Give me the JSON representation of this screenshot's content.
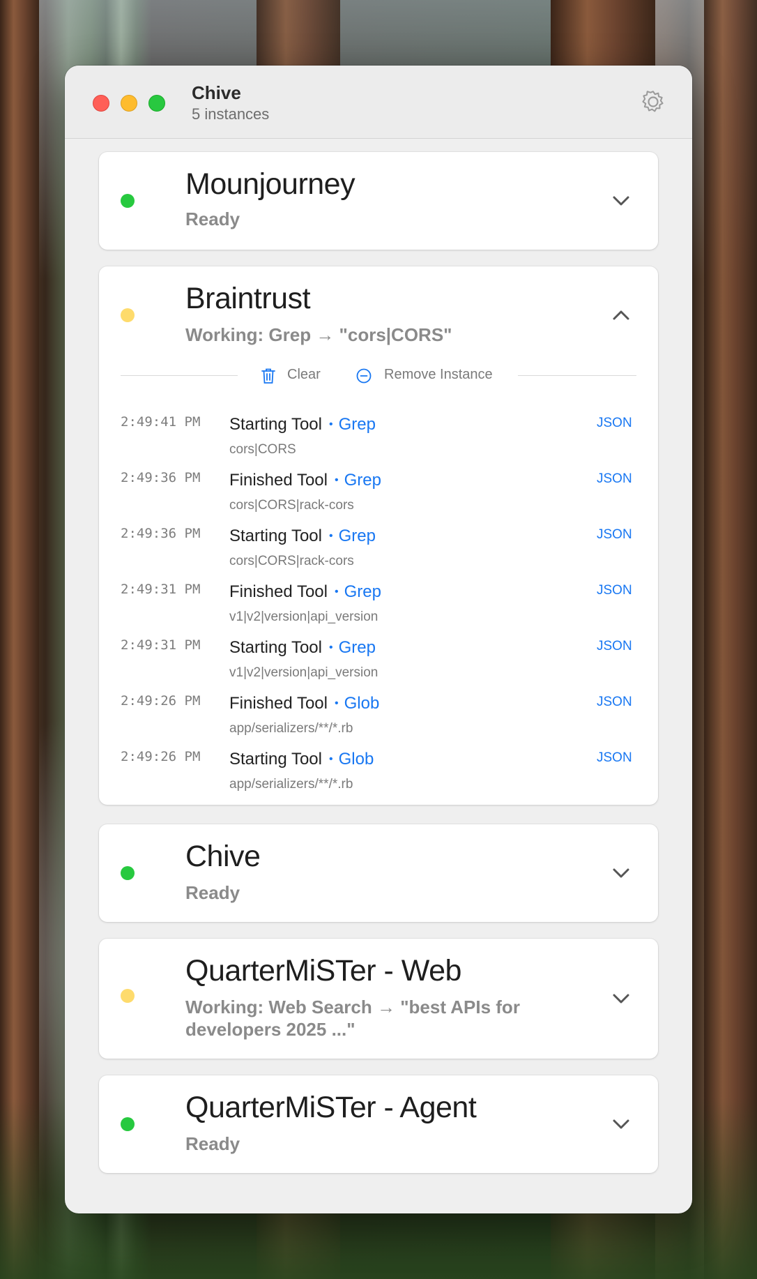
{
  "window": {
    "title": "Chive",
    "subtitle": "5 instances"
  },
  "instances": [
    {
      "name": "Mounjourney",
      "status": "Ready",
      "state": "ready",
      "expanded": false
    },
    {
      "name": "Braintrust",
      "status": "Working: Grep → \"cors|CORS\"",
      "state": "working",
      "expanded": true,
      "actions": {
        "clear": "Clear",
        "remove": "Remove Instance"
      },
      "log": [
        {
          "time": "2:49:41 PM",
          "event": "Starting Tool",
          "tool": "Grep",
          "detail": "cors|CORS",
          "link": "JSON"
        },
        {
          "time": "2:49:36 PM",
          "event": "Finished Tool",
          "tool": "Grep",
          "detail": "cors|CORS|rack-cors",
          "link": "JSON"
        },
        {
          "time": "2:49:36 PM",
          "event": "Starting Tool",
          "tool": "Grep",
          "detail": "cors|CORS|rack-cors",
          "link": "JSON"
        },
        {
          "time": "2:49:31 PM",
          "event": "Finished Tool",
          "tool": "Grep",
          "detail": "v1|v2|version|api_version",
          "link": "JSON"
        },
        {
          "time": "2:49:31 PM",
          "event": "Starting Tool",
          "tool": "Grep",
          "detail": "v1|v2|version|api_version",
          "link": "JSON"
        },
        {
          "time": "2:49:26 PM",
          "event": "Finished Tool",
          "tool": "Glob",
          "detail": "app/serializers/**/*.rb",
          "link": "JSON"
        },
        {
          "time": "2:49:26 PM",
          "event": "Starting Tool",
          "tool": "Glob",
          "detail": "app/serializers/**/*.rb",
          "link": "JSON"
        }
      ]
    },
    {
      "name": "Chive",
      "status": "Ready",
      "state": "ready",
      "expanded": false
    },
    {
      "name": "QuarterMiSTer - Web",
      "status": "Working: Web Search → \"best APIs for developers 2025 ...\"",
      "state": "working",
      "expanded": false
    },
    {
      "name": "QuarterMiSTer - Agent",
      "status": "Ready",
      "state": "ready",
      "expanded": false
    }
  ],
  "colors": {
    "ready": "#27c93f",
    "working": "#fedb6c",
    "link": "#1877f2"
  },
  "icons": [
    "settings-gear-icon",
    "chevron-down-icon",
    "chevron-up-icon",
    "trash-icon",
    "minus-circle-icon"
  ]
}
